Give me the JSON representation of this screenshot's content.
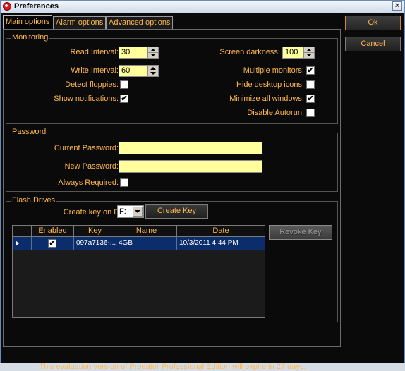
{
  "window": {
    "title": "Preferences",
    "close_glyph": "×",
    "app_icon": "predator-icon"
  },
  "tabs": [
    {
      "label": "Main options",
      "active": true
    },
    {
      "label": "Alarm options",
      "active": false
    },
    {
      "label": "Advanced options",
      "active": false
    }
  ],
  "buttons": {
    "ok": "Ok",
    "cancel": "Cancel",
    "create_key": "Create Key",
    "revoke_key": "Revoke Key"
  },
  "monitoring": {
    "title": "Monitoring",
    "read_interval": {
      "label": "Read Interval:",
      "value": "30"
    },
    "write_interval": {
      "label": "Write Interval:",
      "value": "60"
    },
    "detect_floppies": {
      "label": "Detect floppies:",
      "checked": false
    },
    "show_notifications": {
      "label": "Show notifications:",
      "checked": true
    },
    "screen_darkness": {
      "label": "Screen darkness:",
      "value": "100"
    },
    "multiple_monitors": {
      "label": "Multiple monitors:",
      "checked": true
    },
    "hide_desktop_icons": {
      "label": "Hide desktop icons:",
      "checked": false
    },
    "minimize_all_windows": {
      "label": "Minimize all windows:",
      "checked": true
    },
    "disable_autorun": {
      "label": "Disable Autorun:",
      "checked": false
    }
  },
  "password": {
    "title": "Password",
    "current": {
      "label": "Current Password:",
      "value": ""
    },
    "new": {
      "label": "New Password:",
      "value": ""
    },
    "always_required": {
      "label": "Always Required:",
      "checked": false
    }
  },
  "flash": {
    "title": "Flash Drives",
    "create_key_label": "Create key on Drive:",
    "drive": "F:",
    "columns": [
      "Enabled",
      "Key",
      "Name",
      "Date"
    ],
    "rows": [
      {
        "enabled": true,
        "key": "097a7136-...",
        "name": "4GB",
        "date": "10/3/2011 4:44 PM"
      }
    ]
  },
  "footer": "This evaluation version of Predator Professional Edition will expire in 27 days.",
  "check_glyph": "✔",
  "colors": {
    "accent_text": "#ffb84d",
    "field_bg": "#ffff9c",
    "selected_row": "#0b2d6b",
    "panel_bg": "#0a0a0a"
  }
}
